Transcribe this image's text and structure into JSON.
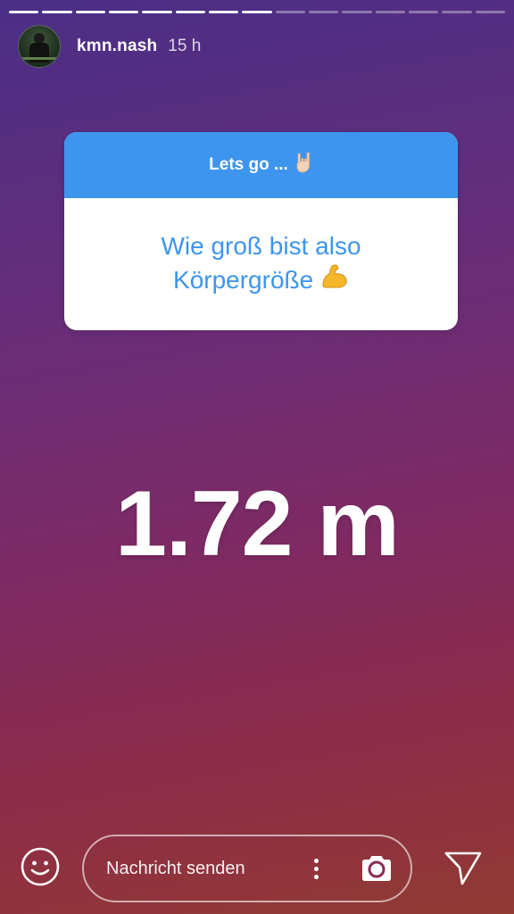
{
  "story": {
    "segments_total": 15,
    "segments_viewed": 8
  },
  "header": {
    "username": "kmn.nash",
    "time": "15 h"
  },
  "question_card": {
    "title": "Lets go ...",
    "title_emoji": "rock-on-hand-emoji",
    "question_line1": "Wie groß bist also",
    "question_line2": "Körpergröße",
    "question_emoji": "flexed-biceps-emoji"
  },
  "answer": {
    "text": "1.72 m"
  },
  "bottom_bar": {
    "emoji_button_icon": "smiley-icon",
    "message_placeholder": "Nachricht senden",
    "more_icon": "vertical-dots-icon",
    "camera_icon": "camera-icon",
    "send_icon": "paper-plane-icon"
  },
  "colors": {
    "card_header": "#3d95ee",
    "question_text": "#3d95ee",
    "background_top": "#4a2f86",
    "background_bottom": "#913b33"
  }
}
